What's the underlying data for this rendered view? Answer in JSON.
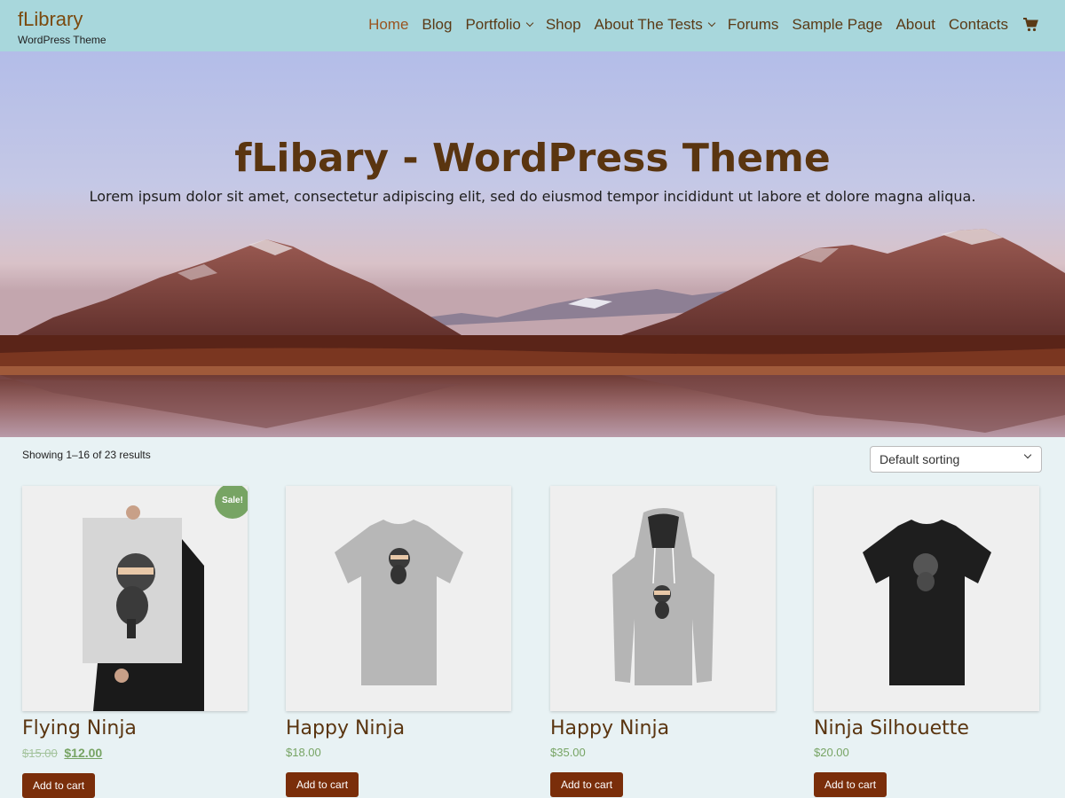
{
  "header": {
    "site_title": "fLibrary",
    "site_description": "WordPress Theme",
    "nav": [
      {
        "label": "Home",
        "active": true
      },
      {
        "label": "Blog"
      },
      {
        "label": "Portfolio",
        "dropdown": true
      },
      {
        "label": "Shop"
      },
      {
        "label": "About The Tests",
        "dropdown": true
      },
      {
        "label": "Forums"
      },
      {
        "label": "Sample Page"
      },
      {
        "label": "About"
      },
      {
        "label": "Contacts"
      }
    ],
    "cart_icon": "shopping-cart-icon"
  },
  "hero": {
    "title": "fLibary - WordPress Theme",
    "subtitle": "Lorem ipsum dolor sit amet, consectetur adipiscing elit, sed do eiusmod tempor incididunt ut labore et dolore magna aliqua."
  },
  "shop": {
    "result_count": "Showing 1–16 of 23 results",
    "sort_selected": "Default sorting",
    "products": [
      {
        "title": "Flying Ninja",
        "old_price": "$15.00",
        "price": "$12.00",
        "sale_badge": "Sale!",
        "button": "Add to cart"
      },
      {
        "title": "Happy Ninja",
        "price": "$18.00",
        "button": "Add to cart"
      },
      {
        "title": "Happy Ninja",
        "price": "$35.00",
        "button": "Add to cart"
      },
      {
        "title": "Ninja Silhouette",
        "price": "$20.00",
        "button": "Add to cart"
      }
    ]
  },
  "colors": {
    "header_bg": "#a8d7dc",
    "page_bg": "#e8f2f4",
    "title_brown": "#5a3510",
    "button_bg": "#7a2e0a",
    "price_green": "#77a464"
  }
}
